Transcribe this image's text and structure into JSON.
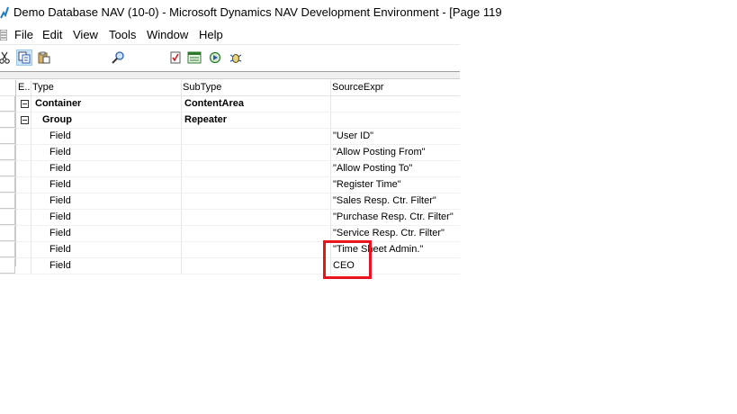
{
  "window": {
    "title": "Demo Database NAV (10-0) - Microsoft Dynamics NAV Development Environment - [Page 119"
  },
  "menu": {
    "items": [
      "File",
      "Edit",
      "View",
      "Tools",
      "Window",
      "Help"
    ]
  },
  "toolbar": {
    "icons": [
      "scissors-icon",
      "copy-icon",
      "paste-icon",
      "find-icon",
      "check-icon",
      "form-icon",
      "run-icon",
      "debug-icon"
    ]
  },
  "grid": {
    "columns": {
      "expand": "E..",
      "type": "Type",
      "subtype": "SubType",
      "source": "SourceExpr"
    },
    "rows": [
      {
        "type": "Container",
        "subtype": "ContentArea",
        "source": ""
      },
      {
        "type": "Group",
        "subtype": "Repeater",
        "source": ""
      },
      {
        "type": "Field",
        "subtype": "",
        "source": "\"User ID\""
      },
      {
        "type": "Field",
        "subtype": "",
        "source": "\"Allow Posting From\""
      },
      {
        "type": "Field",
        "subtype": "",
        "source": "\"Allow Posting To\""
      },
      {
        "type": "Field",
        "subtype": "",
        "source": "\"Register Time\""
      },
      {
        "type": "Field",
        "subtype": "",
        "source": "\"Sales Resp. Ctr. Filter\""
      },
      {
        "type": "Field",
        "subtype": "",
        "source": "\"Purchase Resp. Ctr. Filter\""
      },
      {
        "type": "Field",
        "subtype": "",
        "source": "\"Service Resp. Ctr. Filter\""
      },
      {
        "type": "Field",
        "subtype": "",
        "source": "\"Time Sheet Admin.\""
      },
      {
        "type": "Field",
        "subtype": "",
        "source": "CEO"
      }
    ]
  },
  "colors": {
    "highlight": "#e8151e",
    "toolbar_active": "#cce4f7"
  }
}
